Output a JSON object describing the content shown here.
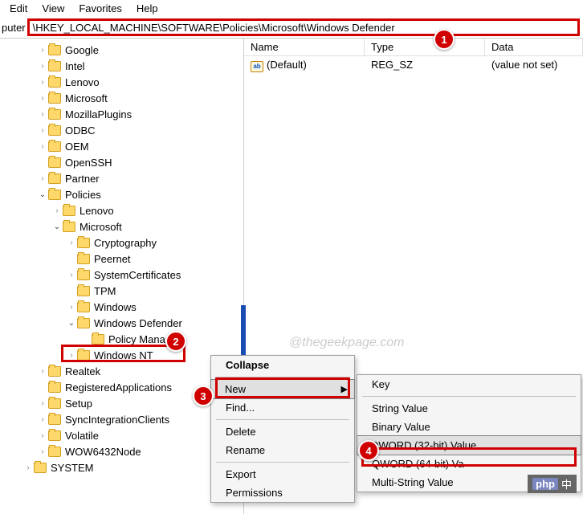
{
  "menu": {
    "edit": "Edit",
    "view": "View",
    "favorites": "Favorites",
    "help": "Help"
  },
  "address": {
    "label": "puter",
    "path": "\\HKEY_LOCAL_MACHINE\\SOFTWARE\\Policies\\Microsoft\\Windows Defender"
  },
  "list": {
    "headers": {
      "name": "Name",
      "type": "Type",
      "data": "Data"
    },
    "rows": [
      {
        "name": "(Default)",
        "type": "REG_SZ",
        "data": "(value not set)"
      }
    ]
  },
  "tree": [
    {
      "indent": 2,
      "label": "Google",
      "exp": ">"
    },
    {
      "indent": 2,
      "label": "Intel",
      "exp": ">"
    },
    {
      "indent": 2,
      "label": "Lenovo",
      "exp": ">"
    },
    {
      "indent": 2,
      "label": "Microsoft",
      "exp": ">"
    },
    {
      "indent": 2,
      "label": "MozillaPlugins",
      "exp": ">"
    },
    {
      "indent": 2,
      "label": "ODBC",
      "exp": ">"
    },
    {
      "indent": 2,
      "label": "OEM",
      "exp": ">"
    },
    {
      "indent": 2,
      "label": "OpenSSH",
      "exp": ""
    },
    {
      "indent": 2,
      "label": "Partner",
      "exp": ">"
    },
    {
      "indent": 2,
      "label": "Policies",
      "exp": "v"
    },
    {
      "indent": 3,
      "label": "Lenovo",
      "exp": ">"
    },
    {
      "indent": 3,
      "label": "Microsoft",
      "exp": "v"
    },
    {
      "indent": 4,
      "label": "Cryptography",
      "exp": ">"
    },
    {
      "indent": 4,
      "label": "Peernet",
      "exp": ""
    },
    {
      "indent": 4,
      "label": "SystemCertificates",
      "exp": ">"
    },
    {
      "indent": 4,
      "label": "TPM",
      "exp": ""
    },
    {
      "indent": 4,
      "label": "Windows",
      "exp": ">"
    },
    {
      "indent": 4,
      "label": "Windows Defender",
      "exp": "v"
    },
    {
      "indent": 5,
      "label": "Policy Manager",
      "exp": ""
    },
    {
      "indent": 4,
      "label": "Windows NT",
      "exp": ">"
    },
    {
      "indent": 2,
      "label": "Realtek",
      "exp": ">"
    },
    {
      "indent": 2,
      "label": "RegisteredApplications",
      "exp": ""
    },
    {
      "indent": 2,
      "label": "Setup",
      "exp": ">"
    },
    {
      "indent": 2,
      "label": "SyncIntegrationClients",
      "exp": ">"
    },
    {
      "indent": 2,
      "label": "Volatile",
      "exp": ">"
    },
    {
      "indent": 2,
      "label": "WOW6432Node",
      "exp": ">"
    },
    {
      "indent": 1,
      "label": "SYSTEM",
      "exp": ">"
    }
  ],
  "ctx1": {
    "collapse": "Collapse",
    "new": "New",
    "find": "Find...",
    "delete": "Delete",
    "rename": "Rename",
    "export": "Export",
    "permissions": "Permissions"
  },
  "ctx2": {
    "key": "Key",
    "string": "String Value",
    "binary": "Binary Value",
    "dword": "DWORD (32-bit) Value",
    "qword": "QWORD (64-bit) Va",
    "multi": "Multi-String Value"
  },
  "badges": {
    "b1": "1",
    "b2": "2",
    "b3": "3",
    "b4": "4"
  },
  "watermark": "@thegeekpage.com",
  "php": {
    "p": "php",
    "cn": "中"
  }
}
